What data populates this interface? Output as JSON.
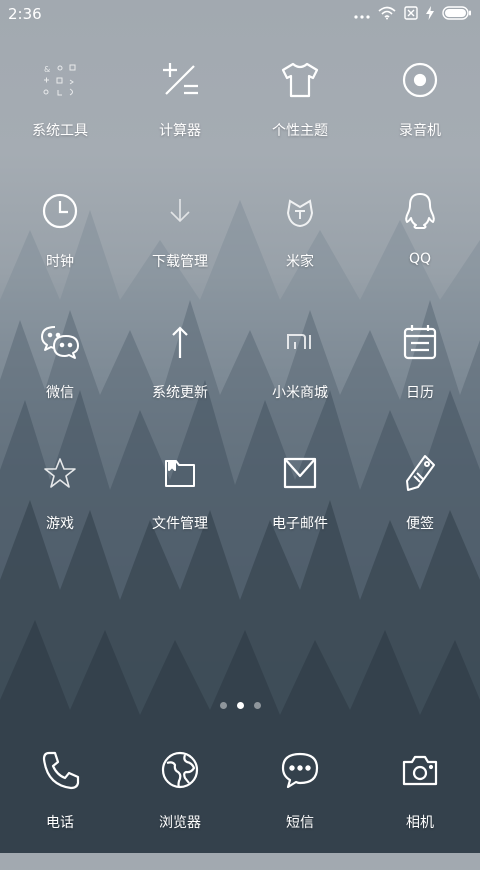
{
  "status_bar": {
    "time": "2:36"
  },
  "grid_apps": [
    {
      "label": "系统工具",
      "icon": "tools-folder-icon"
    },
    {
      "label": "计算器",
      "icon": "calculator-icon"
    },
    {
      "label": "个性主题",
      "icon": "tshirt-icon"
    },
    {
      "label": "录音机",
      "icon": "record-icon"
    },
    {
      "label": "时钟",
      "icon": "clock-icon"
    },
    {
      "label": "下载管理",
      "icon": "download-icon"
    },
    {
      "label": "米家",
      "icon": "mijia-icon"
    },
    {
      "label": "QQ",
      "icon": "qq-penguin-icon"
    },
    {
      "label": "微信",
      "icon": "wechat-icon"
    },
    {
      "label": "系统更新",
      "icon": "arrow-up-icon"
    },
    {
      "label": "小米商城",
      "icon": "mi-logo-icon"
    },
    {
      "label": "日历",
      "icon": "calendar-icon"
    },
    {
      "label": "游戏",
      "icon": "star-icon"
    },
    {
      "label": "文件管理",
      "icon": "folder-icon"
    },
    {
      "label": "电子邮件",
      "icon": "envelope-icon"
    },
    {
      "label": "便签",
      "icon": "tag-pen-icon"
    }
  ],
  "page_indicator": {
    "pages": 3,
    "active": 2
  },
  "dock": [
    {
      "label": "电话",
      "icon": "phone-icon"
    },
    {
      "label": "浏览器",
      "icon": "globe-icon"
    },
    {
      "label": "短信",
      "icon": "chat-bubble-icon"
    },
    {
      "label": "相机",
      "icon": "camera-icon"
    }
  ]
}
